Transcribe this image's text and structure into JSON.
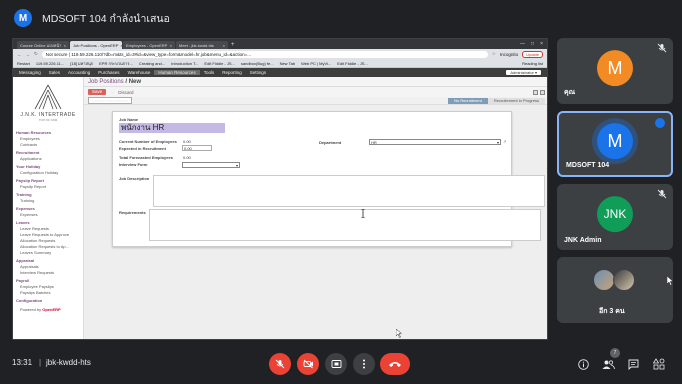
{
  "meeting": {
    "presenter_initial": "M",
    "presenter_title": "MDSOFT 104 กำลังนำเสนอ",
    "time": "13:31",
    "separator": "|",
    "meeting_code": "jbk-kwdd-hts",
    "participant_count": "7"
  },
  "browser": {
    "tabs": [
      {
        "label": "Course Online แบ่งหน้า",
        "active": false
      },
      {
        "label": "Job Positions - OpenERP",
        "active": true
      },
      {
        "label": "Employees - OpenERP",
        "active": false
      },
      {
        "label": "Meet - jbk-kwdd-hts",
        "active": false
      }
    ],
    "new_tab": "+",
    "url": "Not secure | 119.59.226.110/?db=m&ts_id=3#id=&view_type=form&model=hr.job&menu_id=&action=...",
    "incognito": "Incognito",
    "update": "Update",
    "bookmarks": [
      "Restart",
      "119.59.226.11...",
      "[18] มหาสนุก",
      "EPR กระบวนการ...",
      "Creating and...",
      "Introduction T...",
      "Edit Fiddle - JS...",
      "sandbox(Bug) fe...",
      "New Tab",
      "Web PC | MyVi...",
      "Edit Fiddle - JS..."
    ],
    "bookmarks_right": "Reading list"
  },
  "erp": {
    "menu": [
      "Messaging",
      "Sales",
      "Accounting",
      "Purchases",
      "Warehouse",
      "Human Resources",
      "Tools",
      "Reporting",
      "Settings"
    ],
    "menu_selected": "Human Resources",
    "admin": "Administrator ▾",
    "logo_name": "J.N.K. INTERTRADE",
    "logo_sub": "TOP OF NKM",
    "sidebar": [
      {
        "head": "Human Resources",
        "items": [
          "Employees",
          "Contracts"
        ]
      },
      {
        "head": "Recruitment",
        "items": [
          "Applications"
        ]
      },
      {
        "head": "Your Holiday",
        "items": [
          "Configuration Holiday"
        ]
      },
      {
        "head": "Payslip Report",
        "items": [
          "Payslip Report"
        ]
      },
      {
        "head": "Training",
        "items": [
          "Training"
        ]
      },
      {
        "head": "Expenses",
        "items": [
          "Expenses"
        ]
      },
      {
        "head": "Leaves",
        "items": [
          "Leave Requests",
          "Leave Requests to Approve",
          "Allocation Requests",
          "Allocation Requests to Ap...",
          "Leaves Summary"
        ]
      },
      {
        "head": "Appraisal",
        "items": [
          "Appraisals",
          "Interview Requests"
        ]
      },
      {
        "head": "Payroll",
        "items": [
          "Employee Payslips",
          "Payslips Batches"
        ]
      },
      {
        "head": "Configuration",
        "items": []
      }
    ],
    "powered_by_label": "Powered by",
    "powered_by_brand": "OpenERP",
    "breadcrumb_parent": "Job Positions",
    "breadcrumb_sep": " / ",
    "breadcrumb_current": "New",
    "save_label": "Save",
    "or_label": "or",
    "discard_label": "Discard",
    "launch_button": "Launch Recruitment",
    "stages": [
      "No Recruitment",
      "Recruitement in Progress"
    ],
    "form": {
      "job_name_label": "Job Name",
      "job_name_value": "พนักงาน HR",
      "current_employees_label": "Current Number of Employees",
      "current_employees_value": "0.00",
      "expected_recruitment_label": "Expected in Recruitment",
      "expected_recruitment_value": "0.00",
      "total_forecasted_label": "Total Forecasted Employees",
      "total_forecasted_value": "0.00",
      "interview_form_label": "Interview Form",
      "interview_form_value": "",
      "department_label": "Department",
      "department_value": "HR",
      "description_label": "Job Description",
      "requirements_label": "Requirements"
    }
  },
  "tiles": [
    {
      "initial": "M",
      "name": "คุณ",
      "color": "#f28b24",
      "muted": true
    },
    {
      "initial": "M",
      "name": "MDSOFT 104",
      "color": "#1a73e8",
      "speaking": true
    },
    {
      "initial": "JNK",
      "name": "JNK Admin",
      "color": "#0f9d58",
      "muted": true
    },
    {
      "name": "อีก 3 คน",
      "group": true
    }
  ],
  "colors": {
    "hangup": "#ea4335",
    "accent": "#8ab4f8",
    "erp_purple": "#7c4a7e"
  }
}
